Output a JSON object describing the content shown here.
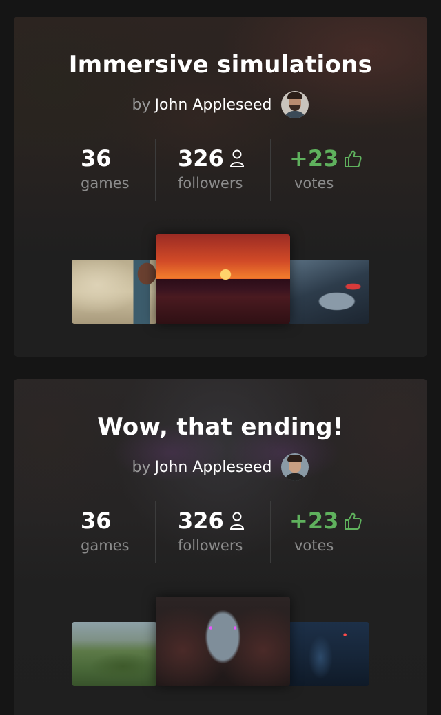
{
  "cards": [
    {
      "title": "Immersive simulations",
      "by": "by",
      "author": "John Appleseed",
      "stats": {
        "games": {
          "value": "36",
          "label": "games"
        },
        "followers": {
          "value": "326",
          "label": "followers"
        },
        "votes": {
          "value": "+23",
          "label": "votes"
        }
      }
    },
    {
      "title": "Wow, that ending!",
      "by": "by",
      "author": "John Appleseed",
      "stats": {
        "games": {
          "value": "36",
          "label": "games"
        },
        "followers": {
          "value": "326",
          "label": "followers"
        },
        "votes": {
          "value": "+23",
          "label": "votes"
        }
      }
    }
  ],
  "colors": {
    "background": "#151515",
    "card": "#1f1f1f",
    "votes_accent": "#5fb15d",
    "muted_text": "#8b8b8b"
  },
  "icons": {
    "followers": "user-icon",
    "votes": "thumbs-up-icon"
  }
}
